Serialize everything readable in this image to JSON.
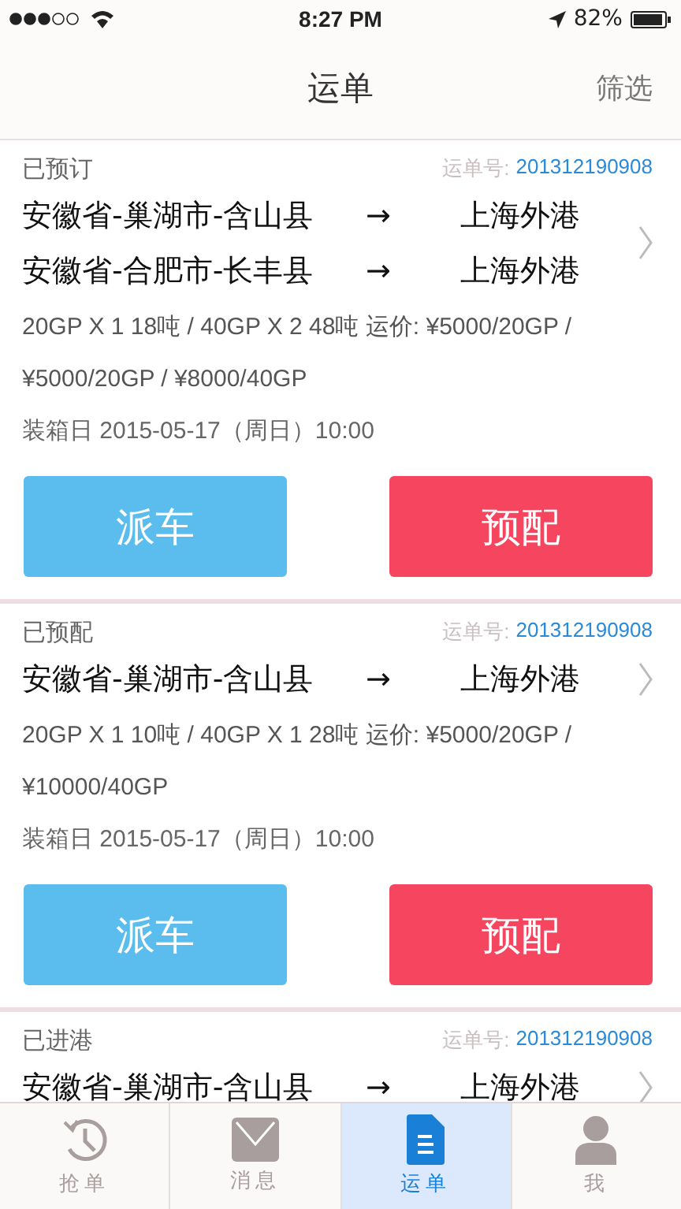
{
  "status_bar": {
    "time": "8:27 PM",
    "battery": "82%"
  },
  "nav": {
    "title": "运单",
    "action": "筛选"
  },
  "orders": [
    {
      "status": "已预订",
      "number_label": "运单号:",
      "number": "201312190908",
      "routes": [
        {
          "from": "安徽省-巢湖市-含山县",
          "arrow": "→",
          "to": "上海外港"
        },
        {
          "from": "安徽省-合肥市-长丰县",
          "arrow": "→",
          "to": "上海外港"
        }
      ],
      "cargo": "20GP X 1  18吨 / 40GP X 2  48吨  运价: ¥5000/20GP / ¥5000/20GP / ¥8000/40GP",
      "date": "装箱日 2015-05-17（周日）10:00",
      "buttons": [
        {
          "label": "派车",
          "kind": "dispatch"
        },
        {
          "label": "预配",
          "kind": "preassign"
        }
      ]
    },
    {
      "status": "已预配",
      "number_label": "运单号:",
      "number": "201312190908",
      "routes": [
        {
          "from": "安徽省-巢湖市-含山县",
          "arrow": "→",
          "to": "上海外港"
        }
      ],
      "cargo": "20GP X 1  10吨 / 40GP X 1  28吨  运价: ¥5000/20GP / ¥10000/40GP",
      "date": "装箱日 2015-05-17（周日）10:00",
      "buttons": [
        {
          "label": "派车",
          "kind": "dispatch"
        },
        {
          "label": "预配",
          "kind": "preassign"
        }
      ]
    },
    {
      "status": "已进港",
      "number_label": "运单号:",
      "number": "201312190908",
      "routes": [
        {
          "from": "安徽省-巢湖市-含山县",
          "arrow": "→",
          "to": "上海外港"
        }
      ]
    }
  ],
  "tabs": [
    {
      "label": "抢单",
      "kind": "clock",
      "selected": false
    },
    {
      "label": "消息",
      "kind": "mail",
      "selected": false
    },
    {
      "label": "运单",
      "kind": "document",
      "selected": true
    },
    {
      "label": "我",
      "kind": "person",
      "selected": false
    }
  ]
}
